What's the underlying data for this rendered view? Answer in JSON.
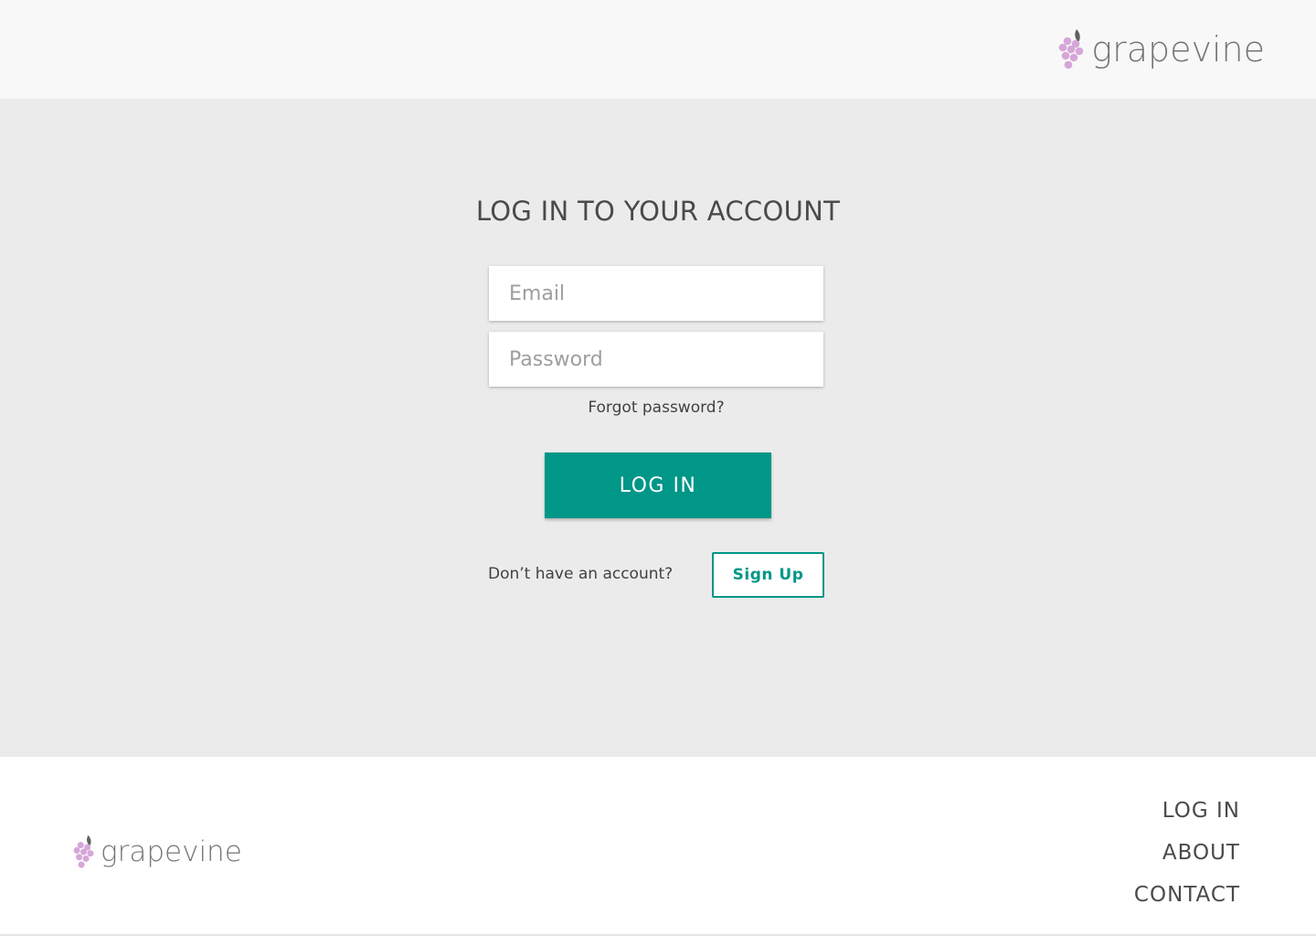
{
  "brand": {
    "name": "grapevine",
    "icon": "grapes-icon",
    "icon_color": "#d6a6d9",
    "leaf_color": "#616161"
  },
  "login": {
    "title": "LOG IN TO YOUR ACCOUNT",
    "email_placeholder": "Email",
    "password_placeholder": "Password",
    "forgot_label": "Forgot password?",
    "submit_label": "LOG IN",
    "no_account_text": "Don’t have an account?",
    "signup_label": "Sign Up"
  },
  "footer": {
    "links": [
      "LOG IN",
      "ABOUT",
      "CONTACT"
    ]
  },
  "colors": {
    "accent": "#009688",
    "header_bg": "#f8f8f8",
    "main_bg": "#ebebeb",
    "footer_bg": "#ffffff"
  }
}
